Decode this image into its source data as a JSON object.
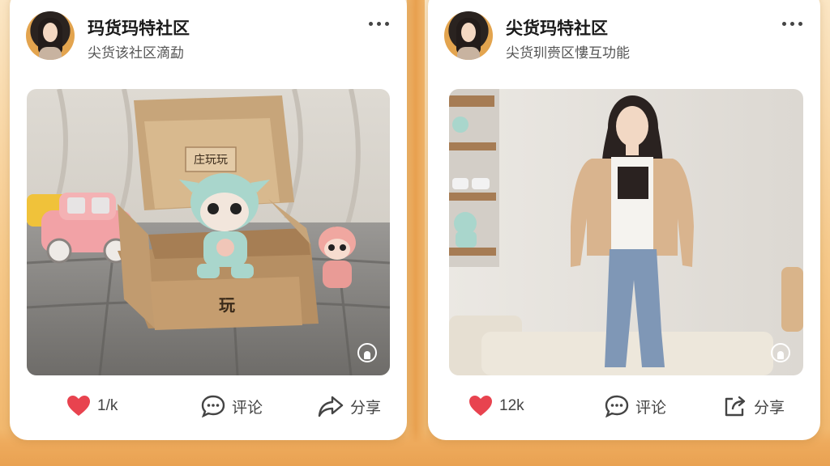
{
  "posts": [
    {
      "author": "玛货玛特社区",
      "subtitle": "尖货该社区滴勐",
      "box_stamp_top": "庄玩玩",
      "box_stamp_front": "玩",
      "likes": "1/k",
      "comment_label": "评论",
      "share_label": "分享"
    },
    {
      "author": "尖货玛特社区",
      "subtitle": "尖货玔赍区慺互功能",
      "likes": "12k",
      "comment_label": "评论",
      "share_label": "分享"
    }
  ],
  "colors": {
    "heart": "#e8434f",
    "background": "#f6c98a",
    "card": "#ffffff"
  },
  "icons": [
    "more-icon",
    "heart-icon",
    "comment-icon",
    "share-icon",
    "photo-badge-icon"
  ]
}
